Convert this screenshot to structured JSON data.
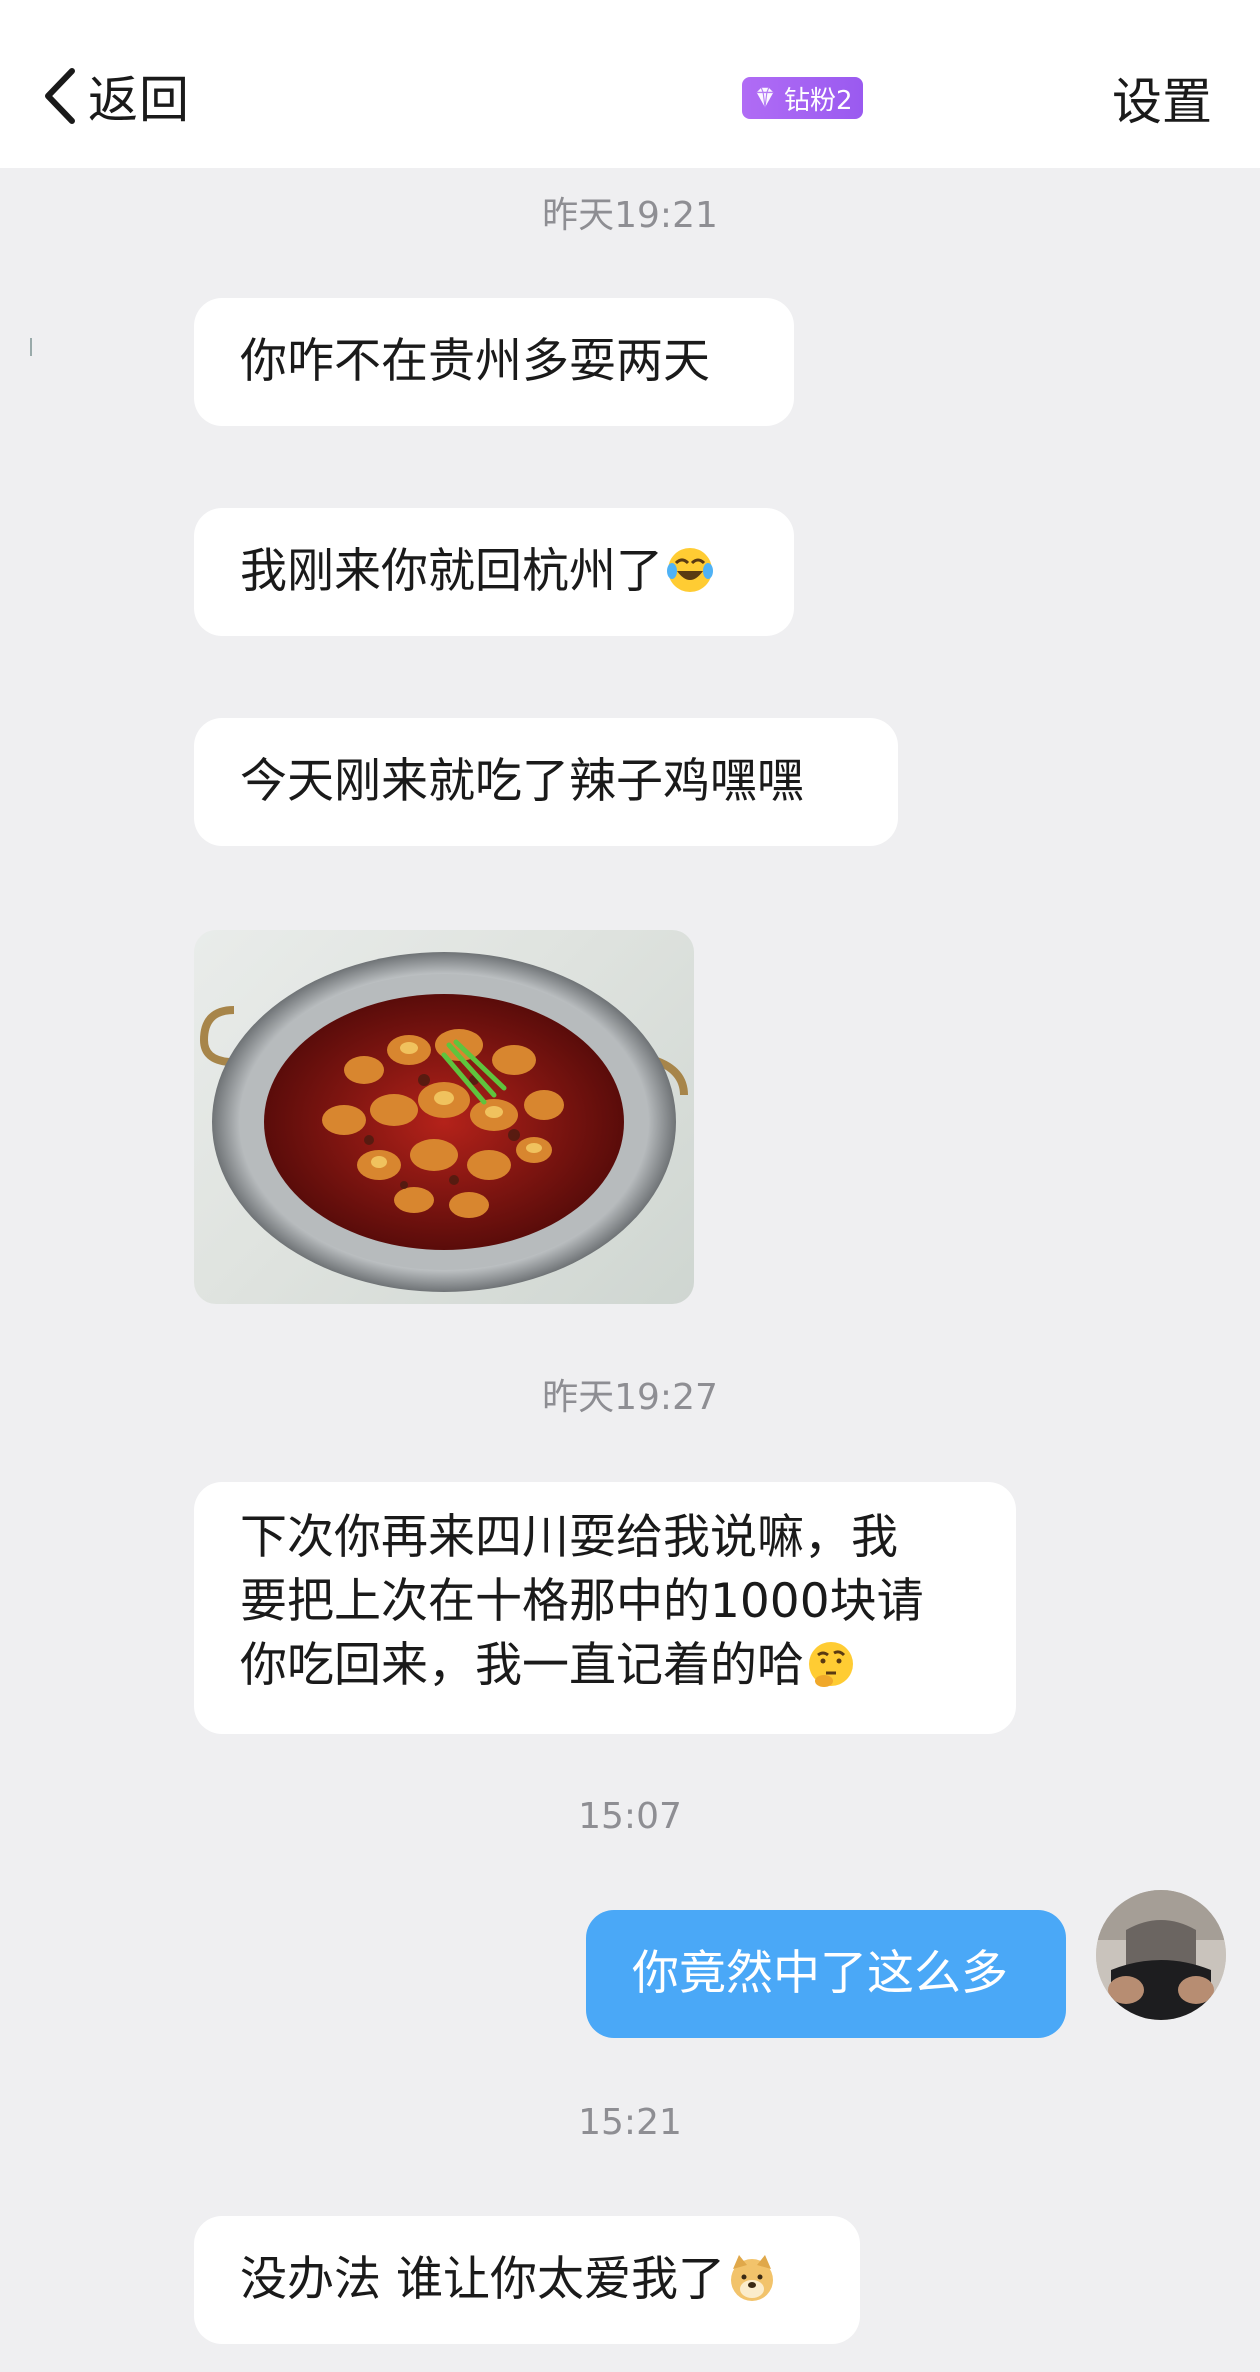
{
  "header": {
    "back_label": "返回",
    "badge_label": "钻粉2",
    "settings_label": "设置",
    "badge_color": "#a564f2"
  },
  "messages": [
    {
      "type": "timestamp",
      "text": "昨天19:21"
    },
    {
      "type": "received",
      "text": "你咋不在贵州多耍两天"
    },
    {
      "type": "received",
      "text": "我刚来你就回杭州了",
      "emoji": "laughing-crying-emoji"
    },
    {
      "type": "received",
      "text": "今天刚来就吃了辣子鸡嘿嘿"
    },
    {
      "type": "received-image",
      "description_icon": "spicy-chicken-photo"
    },
    {
      "type": "timestamp",
      "text": "昨天19:27"
    },
    {
      "type": "received",
      "lines": [
        "下次你再来四川耍给我说嘛，我",
        "要把上次在十格那中的1000块请",
        "你吃回来，我一直记着的哈"
      ],
      "emoji": "thinking-emoji"
    },
    {
      "type": "timestamp",
      "text": "15:07"
    },
    {
      "type": "sent",
      "text": "你竟然中了这么多"
    },
    {
      "type": "timestamp",
      "text": "15:21"
    },
    {
      "type": "received",
      "text": "没办法 谁让你太爱我了",
      "emoji": "doge-emoji"
    }
  ],
  "colors": {
    "background": "#efeff1",
    "received_bubble": "#ffffff",
    "sent_bubble": "#4aa8f7",
    "timestamp_text": "#8e8e93"
  }
}
